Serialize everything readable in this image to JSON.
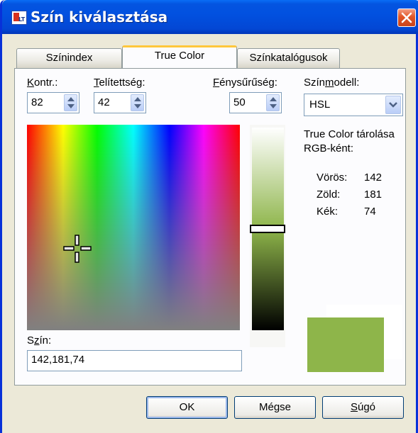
{
  "window": {
    "title": "Szín kiválasztása"
  },
  "tabs": [
    {
      "label": "Színindex",
      "active": false
    },
    {
      "label": "True Color",
      "active": true
    },
    {
      "label": "Színkatalógusok",
      "active": false
    }
  ],
  "controls": {
    "contrast": {
      "label_ul": "K",
      "label_rest": "ontr.:",
      "value": "82"
    },
    "saturation": {
      "label_ul": "T",
      "label_rest": "elítettség:",
      "value": "42"
    },
    "luminance": {
      "label_ul": "F",
      "label_rest": "énysűrűség:",
      "value": "50"
    },
    "color_model": {
      "label_pre": "Szín",
      "label_ul": "m",
      "label_rest": "odell:",
      "value": "HSL"
    }
  },
  "info": {
    "line1": "True Color tárolása",
    "line2": "RGB-ként:",
    "rows": [
      {
        "label": "Vörös:",
        "value": "142"
      },
      {
        "label": "Zöld:",
        "value": "181"
      },
      {
        "label": "Kék:",
        "value": "74"
      }
    ]
  },
  "color_field": {
    "label_pre": "S",
    "label_ul": "z",
    "label_rest": "ín:",
    "value": "142,181,74"
  },
  "colors": {
    "selected": "#8eb54a",
    "previous": "#ffffff"
  },
  "buttons": {
    "ok": "OK",
    "cancel": "Mégse",
    "help_ul": "S",
    "help_rest": "úgó"
  }
}
